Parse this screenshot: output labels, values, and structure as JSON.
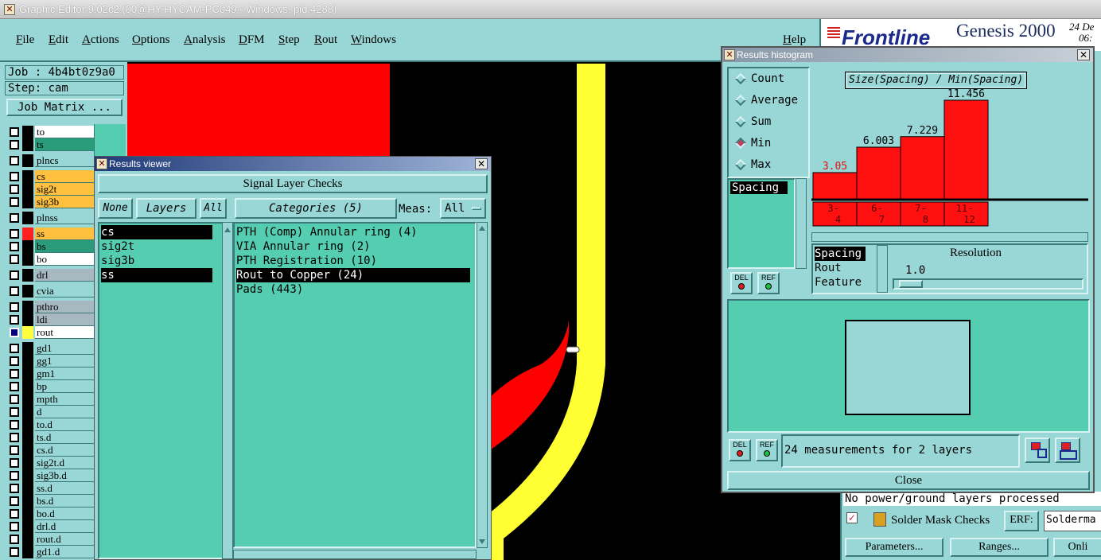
{
  "window_title": "Graphic Editor 9.02c2 (00@HY-HYCAM-PC049 - Windows, pid:4288)",
  "menu": [
    "File",
    "Edit",
    "Actions",
    "Options",
    "Analysis",
    "DFM",
    "Step",
    "Rout",
    "Windows"
  ],
  "help": "Help",
  "brand": {
    "logo": "Frontline",
    "product": "Genesis 2000",
    "date": "24 De",
    "time": "06:"
  },
  "job": {
    "job": "Job : 4b4bt0z9a0",
    "step": "Step: cam",
    "matrix_button": "Job Matrix ..."
  },
  "layers": [
    {
      "name": "to",
      "color": "#ffffff"
    },
    {
      "name": "ts",
      "color": "#2a9c7c"
    },
    {
      "name": "plncs",
      "color": "#99d6d6"
    },
    {
      "name": "cs",
      "color": "#ffc040"
    },
    {
      "name": "sig2t",
      "color": "#ffc040"
    },
    {
      "name": "sig3b",
      "color": "#ffc040"
    },
    {
      "name": "plnss",
      "color": "#99d6d6"
    },
    {
      "name": "ss",
      "color": "#ffc040"
    },
    {
      "name": "bs",
      "color": "#2a9c7c"
    },
    {
      "name": "bo",
      "color": "#ffffff"
    },
    {
      "name": "drl",
      "color": "#a8b8c0"
    },
    {
      "name": "cvia",
      "color": "#99d6d6"
    },
    {
      "name": "pthro",
      "color": "#a8b8c0"
    },
    {
      "name": "ldi",
      "color": "#a8b8c0"
    },
    {
      "name": "rout",
      "color": "#ffffff"
    },
    {
      "name": "gd1",
      "color": "#99d6d6"
    },
    {
      "name": "gg1",
      "color": "#99d6d6"
    },
    {
      "name": "gm1",
      "color": "#99d6d6"
    },
    {
      "name": "bp",
      "color": "#99d6d6"
    },
    {
      "name": "mpth",
      "color": "#99d6d6"
    },
    {
      "name": "d",
      "color": "#99d6d6"
    },
    {
      "name": "to.d",
      "color": "#99d6d6"
    },
    {
      "name": "ts.d",
      "color": "#99d6d6"
    },
    {
      "name": "cs.d",
      "color": "#99d6d6"
    },
    {
      "name": "sig2t.d",
      "color": "#99d6d6"
    },
    {
      "name": "sig3b.d",
      "color": "#99d6d6"
    },
    {
      "name": "ss.d",
      "color": "#99d6d6"
    },
    {
      "name": "bs.d",
      "color": "#99d6d6"
    },
    {
      "name": "bo.d",
      "color": "#99d6d6"
    },
    {
      "name": "drl.d",
      "color": "#99d6d6"
    },
    {
      "name": "rout.d",
      "color": "#99d6d6"
    },
    {
      "name": "gd1.d",
      "color": "#99d6d6"
    }
  ],
  "results_viewer": {
    "title": "Results viewer",
    "header": "Signal Layer Checks",
    "none_btn": "None",
    "layers_btn": "Layers",
    "all_btn": "All",
    "categories_btn": "Categories (5)",
    "meas_label": "Meas:",
    "meas_value": "All",
    "layer_items": [
      "cs",
      "sig2t",
      "sig3b",
      "ss"
    ],
    "categories": [
      "PTH (Comp) Annular ring (4)",
      "VIA Annular ring (2)",
      "PTH Registration (10)",
      "Rout to Copper (24)",
      "Pads (443)"
    ]
  },
  "results_histogram": {
    "title": "Results histogram",
    "stats": [
      "Count",
      "Average",
      "Sum",
      "Min",
      "Max"
    ],
    "selected_stat": "Min",
    "chart_title": "Size(Spacing) / Min(Spacing)",
    "field_list": [
      "Spacing"
    ],
    "size_options": [
      "Spacing",
      "Rout",
      "Feature"
    ],
    "resolution_label": "Resolution",
    "resolution_value": "1.0",
    "del_label": "DEL",
    "ref_label": "REF",
    "status": "24 measurements for 2 layers",
    "close": "Close"
  },
  "chart_data": {
    "type": "bar",
    "title": "Size(Spacing) / Min(Spacing)",
    "categories": [
      "3-4",
      "6-7",
      "7-8",
      "11-12"
    ],
    "category_labels": [
      [
        "3-",
        "4"
      ],
      [
        "6-",
        "7"
      ],
      [
        "7-",
        "8"
      ],
      [
        "11-",
        "12"
      ]
    ],
    "values": [
      3.05,
      6.003,
      7.229,
      11.456
    ],
    "value_labels": [
      "3.05",
      "6.003",
      "7.229",
      "11.456"
    ],
    "ylim": [
      0,
      11.456
    ],
    "bar_color": "#ff1010"
  },
  "background_panel": {
    "message": "No power/ground layers processed",
    "solder_mask": "Solder Mask Checks",
    "erf_label": "ERF:",
    "erf_value": "Solderma",
    "parameters_btn": "Parameters...",
    "ranges_btn": "Ranges...",
    "online_btn": "Onli"
  }
}
